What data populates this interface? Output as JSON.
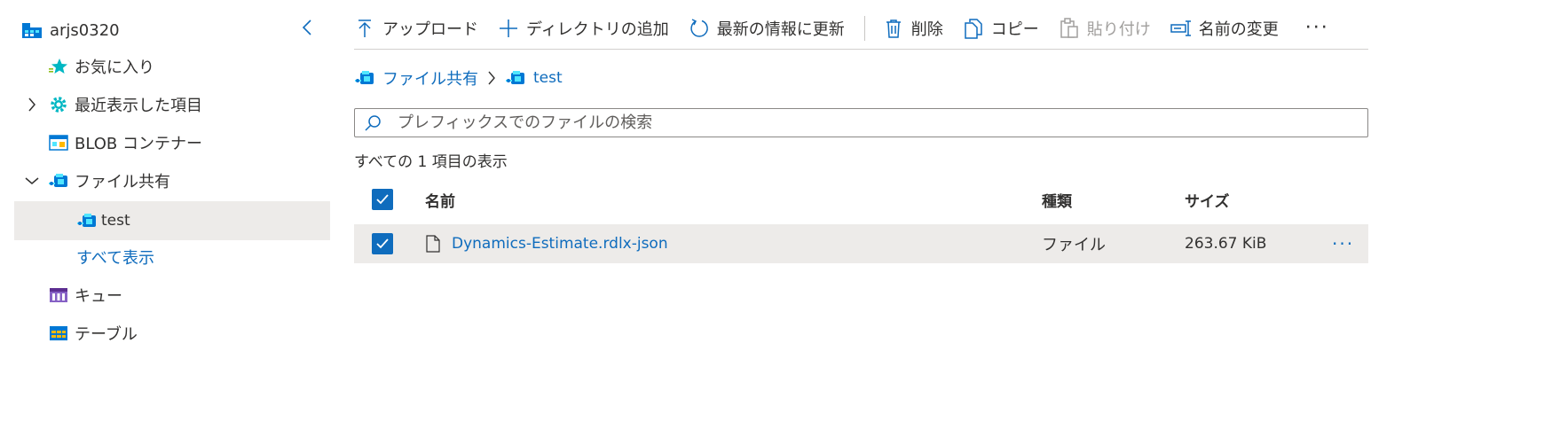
{
  "sidebar": {
    "account": "arjs0320",
    "items": [
      {
        "label": "お気に入り"
      },
      {
        "label": "最近表示した項目"
      },
      {
        "label": "BLOB コンテナー"
      },
      {
        "label": "ファイル共有"
      },
      {
        "label": "test"
      },
      {
        "label": "すべて表示"
      },
      {
        "label": "キュー"
      },
      {
        "label": "テーブル"
      }
    ]
  },
  "toolbar": {
    "upload": "アップロード",
    "add_directory": "ディレクトリの追加",
    "refresh": "最新の情報に更新",
    "delete": "削除",
    "copy": "コピー",
    "paste": "貼り付け",
    "rename": "名前の変更",
    "more": "···"
  },
  "breadcrumb": {
    "items": [
      {
        "label": "ファイル共有"
      },
      {
        "label": "test"
      }
    ]
  },
  "search": {
    "placeholder": "プレフィックスでのファイルの検索",
    "value": ""
  },
  "list": {
    "count_text": "すべての 1 項目の表示",
    "columns": {
      "name": "名前",
      "type": "種類",
      "size": "サイズ"
    },
    "rows": [
      {
        "name": "Dynamics-Estimate.rdlx-json",
        "type": "ファイル",
        "size": "263.67 KiB",
        "selected": true
      }
    ],
    "row_more": "···"
  },
  "colors": {
    "accent": "#0f6cbd",
    "selected_bg": "#edebe9",
    "text": "#323130"
  }
}
